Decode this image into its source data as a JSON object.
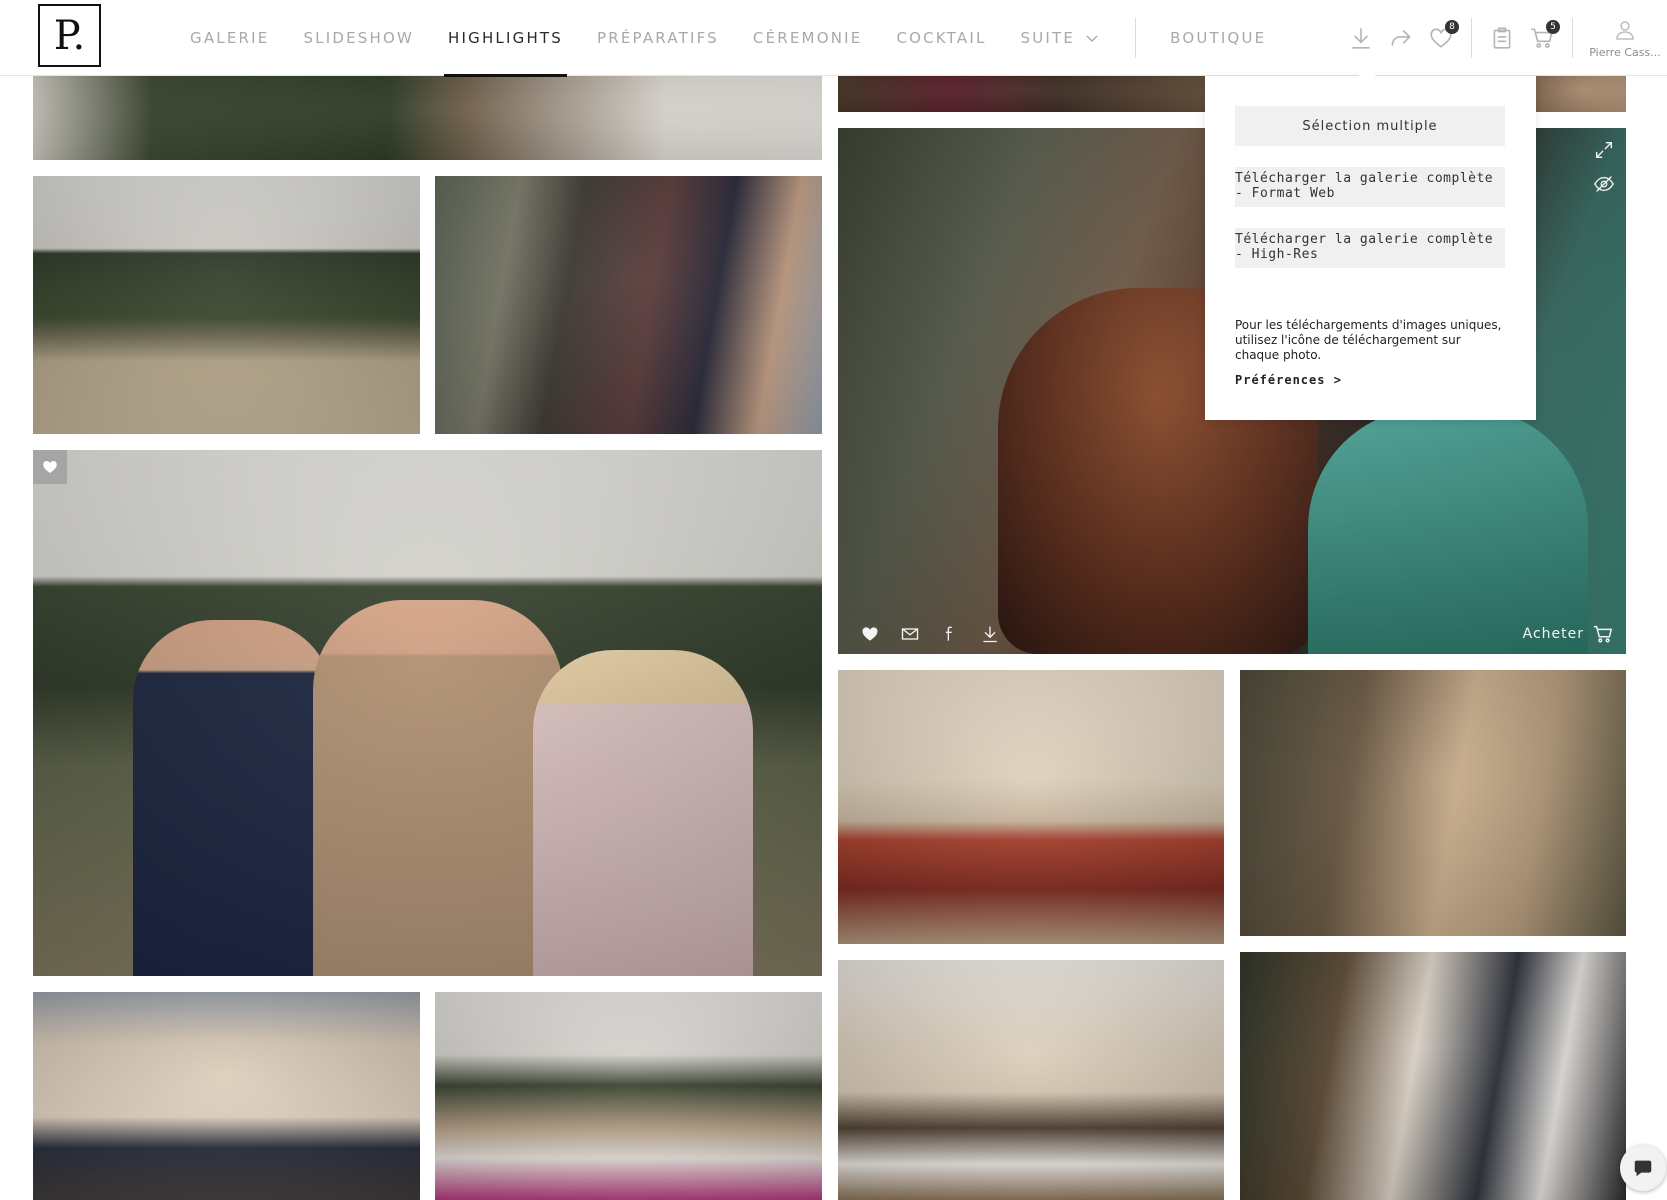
{
  "brand": {
    "logo_text": "P."
  },
  "nav": {
    "items": [
      {
        "label": "GALERIE"
      },
      {
        "label": "SLIDESHOW"
      },
      {
        "label": "HIGHLIGHTS",
        "active": true
      },
      {
        "label": "PRÉPARATIFS"
      },
      {
        "label": "CÉREMONIE"
      },
      {
        "label": "COCKTAIL"
      },
      {
        "label": "SUITE"
      }
    ],
    "shop_label": "BOUTIQUE"
  },
  "toolbar": {
    "icons": [
      "download-icon",
      "share-icon",
      "heart-icon",
      "clipboard-icon",
      "cart-icon",
      "user-icon"
    ],
    "favorites_count": "8",
    "cart_count": "5",
    "user_name": "Pierre Cass..."
  },
  "download_menu": {
    "multiple_selection": "Sélection multiple",
    "full_web": "Télécharger la galerie complète - Format Web",
    "full_hires": "Télécharger la galerie complète - High-Res",
    "note": "Pour les téléchargements d'images uniques, utilisez l'icône de téléchargement sur chaque photo.",
    "preferences": "Préférences >"
  },
  "photo_actions": {
    "buy_label": "Acheter",
    "icons": [
      "heart-icon",
      "mail-icon",
      "facebook-icon",
      "download-icon",
      "expand-icon",
      "hide-icon",
      "cart-icon"
    ]
  },
  "colors": {
    "text_active": "#2b2b2b",
    "text_muted": "#a9a9a9",
    "menu_button_bg": "#f0f0f0"
  }
}
